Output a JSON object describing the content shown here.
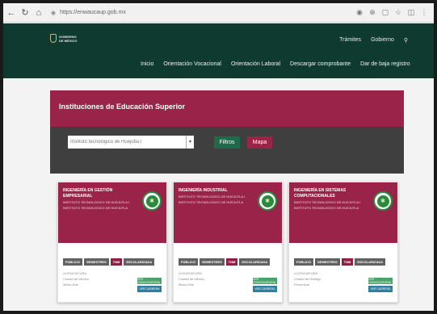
{
  "browser": {
    "url": "https://enwaucaup.gob.mx"
  },
  "header": {
    "logo_text": "GOBIERNO DE MÉXICO",
    "links": [
      "Trámites",
      "Gobierno"
    ]
  },
  "menu": {
    "items": [
      "Inicio",
      "Orientación Vocacional",
      "Orientación Laboral",
      "Descargar comprobante",
      "Dar de baja registro"
    ]
  },
  "panel": {
    "title": "Instituciones de Educación Superior",
    "search_value": "Instituto tecnológico de Huejutla I",
    "filtros_label": "Filtros",
    "mapa_label": "Mapa"
  },
  "cards": [
    {
      "title": "INGENIERÍA EN GESTIÓN EMPRESARIAL",
      "institution": "INSTITUTO TECNOLOGICO DE HUEJUTLA I",
      "campus": "INSTITUTO TECNOLOGICO DE HUEJUTLA",
      "tags": [
        "PÚBLICO",
        "SEMESTRES",
        "TNM",
        "ESCOLARIZADA"
      ],
      "level": "LICENCIATURA",
      "location": "Ciudad de México",
      "modality": "Mixta-Vide",
      "btn1": "VER CONVOCATORIA",
      "btn2": "VER CARRERA"
    },
    {
      "title": "INGENIERÍA INDUSTRIAL",
      "institution": "INSTITUTO TECNOLOGICO DE HUEJUTLA I",
      "campus": "INSTITUTO TECNOLOGICO DE HUEJUTLA",
      "tags": [
        "PÚBLICO",
        "SEMESTRES",
        "TNM",
        "ESCOLARIZADA"
      ],
      "level": "LICENCIATURA",
      "location": "Ciudad de México",
      "modality": "Mixta-Vide",
      "btn1": "VER CONVOCATORIA",
      "btn2": "VER CARRERA"
    },
    {
      "title": "INGENIERÍA EN SISTEMAS COMPUTACIONALES",
      "institution": "INSTITUTO TECNOLOGICO DE HUEJUTLA I",
      "campus": "INSTITUTO TECNOLOGICO DE HUEJUTLA",
      "tags": [
        "PÚBLICO",
        "SEMESTRES",
        "TNM",
        "ESCOLARIZADA"
      ],
      "level": "LICENCIATURA",
      "location": "Ciudad de Hidalgo",
      "modality": "Presencial",
      "btn1": "VER CONVOCATORIA",
      "btn2": "VER CARRERA"
    }
  ]
}
